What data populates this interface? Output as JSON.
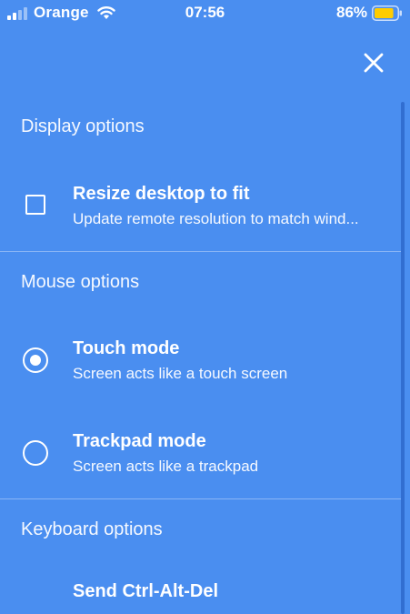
{
  "status_bar": {
    "carrier": "Orange",
    "time": "07:56",
    "battery_percent": "86%",
    "battery_level": 0.86,
    "battery_color": "#ffcc00",
    "icons": [
      "signal-icon",
      "wifi-icon",
      "battery-icon"
    ]
  },
  "close_icon": "close-icon",
  "sections": {
    "display": {
      "header": "Display options",
      "options": [
        {
          "title": "Resize desktop to fit",
          "subtitle": "Update remote resolution to match wind...",
          "control": "checkbox",
          "checked": false
        }
      ]
    },
    "mouse": {
      "header": "Mouse options",
      "options": [
        {
          "title": "Touch mode",
          "subtitle": "Screen acts like a touch screen",
          "control": "radio",
          "selected": true
        },
        {
          "title": "Trackpad mode",
          "subtitle": "Screen acts like a trackpad",
          "control": "radio",
          "selected": false
        }
      ]
    },
    "keyboard": {
      "header": "Keyboard options",
      "options": [
        {
          "title": "Send Ctrl-Alt-Del"
        }
      ]
    }
  },
  "colors": {
    "background": "#4a8ef0",
    "text": "#ffffff"
  }
}
